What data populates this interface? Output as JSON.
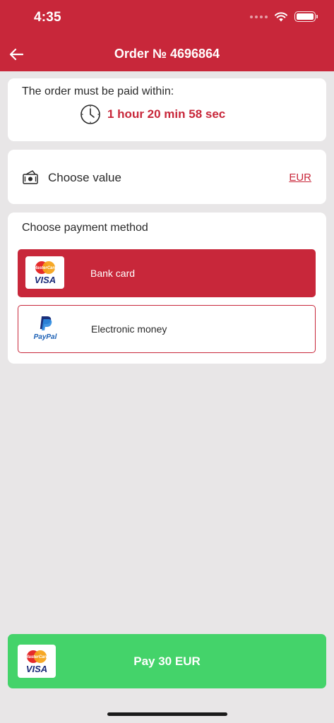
{
  "status_bar": {
    "time": "4:35"
  },
  "header": {
    "title": "Order № 4696864"
  },
  "timer": {
    "label": "The order must be paid within:",
    "value": "1 hour 20 min 58 sec"
  },
  "value_section": {
    "label": "Choose value",
    "currency": "EUR"
  },
  "payment": {
    "label": "Choose payment method",
    "methods": [
      {
        "label": "Bank card",
        "selected": true
      },
      {
        "label": "Electronic money",
        "selected": false
      }
    ]
  },
  "logos": {
    "mastercard_text": "MasterCard",
    "visa_text": "VISA",
    "paypal_text": "PayPal"
  },
  "pay_button": {
    "label": "Pay 30 EUR"
  },
  "colors": {
    "brand_red": "#c8273a",
    "pay_green": "#44d36a",
    "background": "#e8e6e7"
  }
}
